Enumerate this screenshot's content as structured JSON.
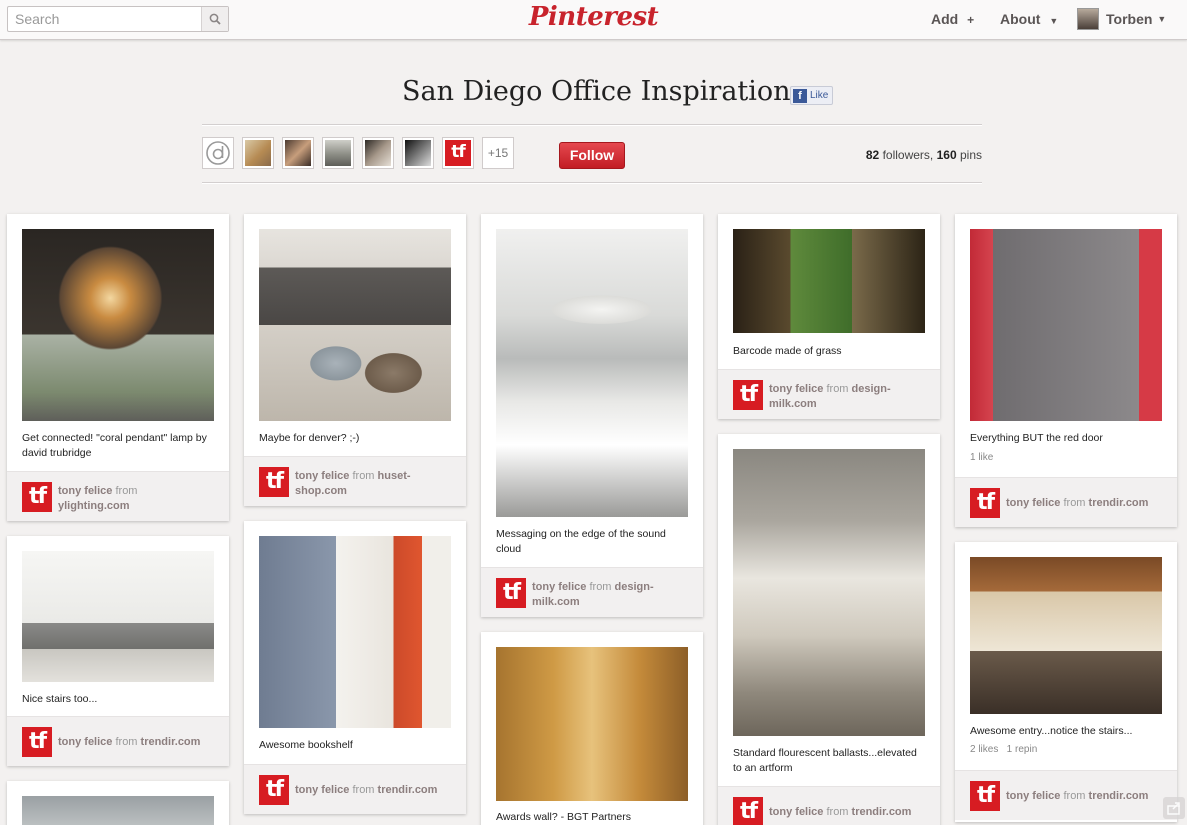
{
  "header": {
    "search_placeholder": "Search",
    "logo_text": "Pinterest",
    "nav_add": "Add",
    "nav_add_symbol": "+",
    "nav_about": "About",
    "caret": "▼",
    "user_name": "Torben"
  },
  "board": {
    "title": "San Diego Office Inspiration",
    "like_label": "Like",
    "fb_letter": "f",
    "follow_label": "Follow",
    "more_contributors": "+15",
    "followers_count": "82",
    "followers_label": "followers,",
    "pins_count": "160",
    "pins_label": "pins"
  },
  "pinner_initials": "tf",
  "pins": [
    {
      "description": "Get connected! \"coral pendant\" lamp by david trubridge",
      "stats": "",
      "pinner": "tony felice",
      "from_label": "from",
      "source": "ylighting.com"
    },
    {
      "description": "Nice stairs too...",
      "stats": "",
      "pinner": "tony felice",
      "from_label": "from",
      "source": "trendir.com"
    },
    {
      "description": "Maybe for denver? ;-)",
      "stats": "",
      "pinner": "tony felice",
      "from_label": "from",
      "source": "huset-shop.com"
    },
    {
      "description": "Awesome bookshelf",
      "stats": "",
      "pinner": "tony felice",
      "from_label": "from",
      "source": "trendir.com"
    },
    {
      "description": "Messaging on the edge of the sound cloud",
      "stats": "",
      "pinner": "tony felice",
      "from_label": "from",
      "source": "design-milk.com"
    },
    {
      "description": "Awards wall? - BGT Partners",
      "stats": "",
      "pinner": "",
      "from_label": "",
      "source": ""
    },
    {
      "description": "Barcode made of grass",
      "stats": "",
      "pinner": "tony felice",
      "from_label": "from",
      "source": "design-milk.com"
    },
    {
      "description": "Standard flourescent ballasts...elevated to an artform",
      "stats": "",
      "pinner": "tony felice",
      "from_label": "from",
      "source": "trendir.com"
    },
    {
      "description": "Everything BUT the red door",
      "stats": "1 like",
      "pinner": "tony felice",
      "from_label": "from",
      "source": "trendir.com"
    },
    {
      "description": "Awesome entry...notice the stairs...",
      "stats": "2 likes   1 repin",
      "pinner": "tony felice",
      "from_label": "from",
      "source": "trendir.com"
    }
  ],
  "colors": {
    "brand_red": "#c8232c",
    "follow_red": "#d42f36",
    "background": "#f3f1f0",
    "facebook_blue": "#3b5998"
  },
  "icons": {
    "search": "search-icon",
    "share": "share-icon"
  }
}
